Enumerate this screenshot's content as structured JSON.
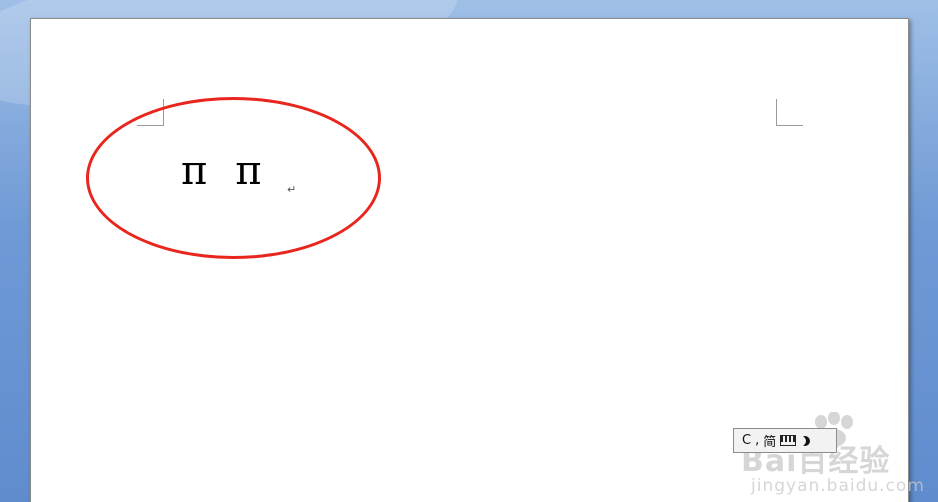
{
  "document": {
    "pi_symbols": [
      "π",
      "π"
    ],
    "paragraph_mark": "↵"
  },
  "annotation": {
    "shape": "ellipse",
    "color": "#e8261e"
  },
  "ime_status": {
    "mode_label": "C",
    "punctuation": ",",
    "script_label": "简",
    "icons": [
      "keyboard-icon",
      "moon-icon"
    ]
  },
  "watermark": {
    "brand_text": "Bai百经验",
    "url_text": "jingyan.baidu.com"
  },
  "colors": {
    "background": "#6f9ad6",
    "page": "#ffffff",
    "annotation_red": "#e8261e"
  }
}
